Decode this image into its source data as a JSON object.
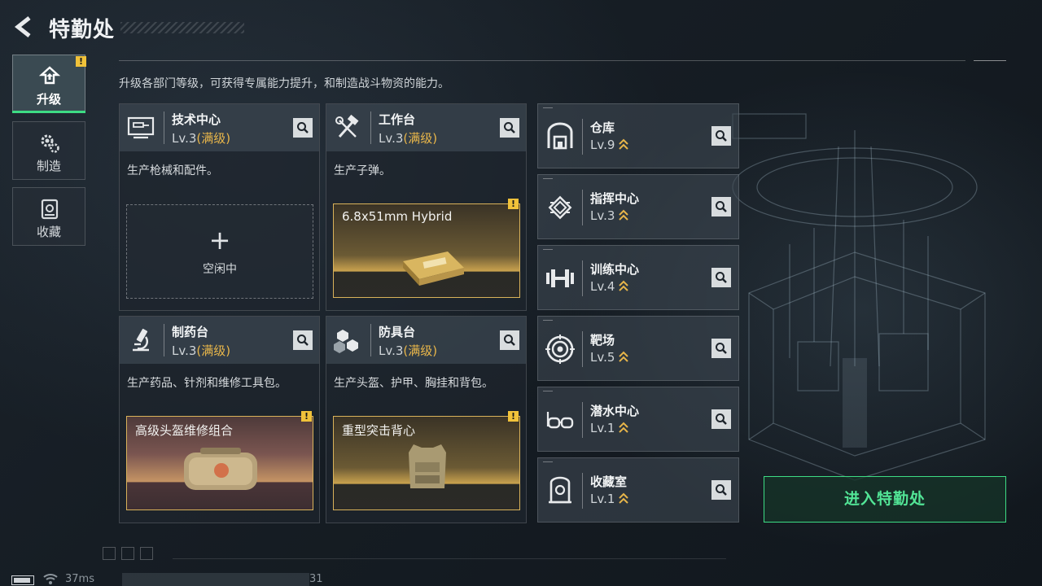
{
  "header": {
    "title": "特勤处"
  },
  "subtitle": "升级各部门等级，可获得专属能力提升，和制造战斗物资的能力。",
  "sidebar": {
    "items": [
      {
        "label": "升级",
        "icon": "upgrade-icon",
        "active": true,
        "alert": "!"
      },
      {
        "label": "制造",
        "icon": "gears-icon",
        "active": false
      },
      {
        "label": "收藏",
        "icon": "collection-icon",
        "active": false
      }
    ]
  },
  "facilities": [
    {
      "name": "技术中心",
      "level": "Lv.3",
      "status": "(满级)",
      "desc": "生产枪械和配件。",
      "slot": {
        "state": "empty",
        "plus": "+",
        "label": "空闲中"
      }
    },
    {
      "name": "工作台",
      "level": "Lv.3",
      "status": "(满级)",
      "desc": "生产子弹。",
      "slot": {
        "state": "producing",
        "label": "6.8x51mm Hybrid",
        "alert": "!"
      }
    },
    {
      "name": "制药台",
      "level": "Lv.3",
      "status": "(满级)",
      "desc": "生产药品、针剂和维修工具包。",
      "slot": {
        "state": "producing",
        "label": "高级头盔维修组合",
        "alert": "!"
      }
    },
    {
      "name": "防具台",
      "level": "Lv.3",
      "status": "(满级)",
      "desc": "生产头盔、护甲、胸挂和背包。",
      "slot": {
        "state": "producing",
        "label": "重型突击背心",
        "alert": "!"
      }
    }
  ],
  "rooms": [
    {
      "name": "仓库",
      "level": "Lv.9",
      "icon": "warehouse-icon"
    },
    {
      "name": "指挥中心",
      "level": "Lv.3",
      "icon": "chip-icon"
    },
    {
      "name": "训练中心",
      "level": "Lv.4",
      "icon": "dumbbell-icon"
    },
    {
      "name": "靶场",
      "level": "Lv.5",
      "icon": "target-icon"
    },
    {
      "name": "潜水中心",
      "level": "Lv.1",
      "icon": "goggles-icon"
    },
    {
      "name": "收藏室",
      "level": "Lv.1",
      "icon": "collection-room-icon"
    }
  ],
  "enter_button": "进入特勤处",
  "status_bar": {
    "ping": "37ms",
    "uid_tail": "31"
  },
  "colors": {
    "accent": "#3ddc84",
    "max_level": "#e8b64a",
    "alert": "#f0c23a"
  }
}
